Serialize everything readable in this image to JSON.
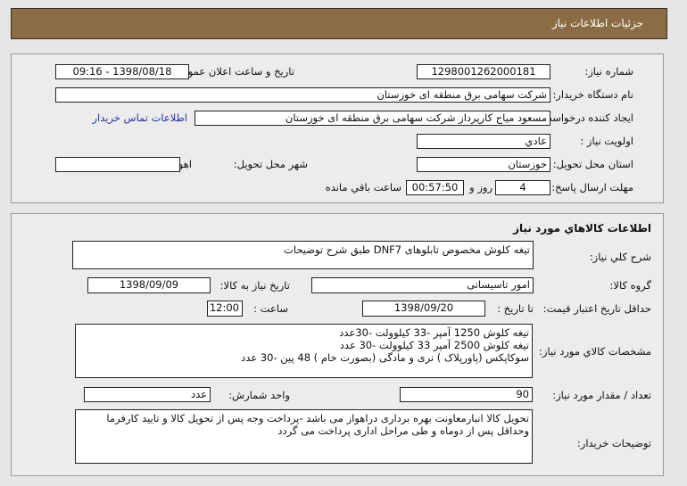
{
  "header": {
    "title": "جزئیات اطلاعات نیاز"
  },
  "need_info": {
    "need_number_label": "شماره نیاز:",
    "need_number": "1298001262000181",
    "announce_label": "تاریخ و ساعت اعلان عمومی:",
    "announce_value": "1398/08/18 - 09:16",
    "buyer_org_label": "نام دستگاه خریدار:",
    "buyer_org": "شرکت سهامی برق منطقه ای خوزستان",
    "creator_label": "ایجاد کننده درخواست:",
    "creator": "مسعود میاح کارپرداز شرکت سهامی برق منطقه ای خوزستان",
    "contact_link": "اطلاعات تماس خریدار",
    "priority_label": "اولویت نیاز :",
    "priority": "عادي",
    "province_label": "استان محل تحویل:",
    "province": "خوزستان",
    "city_label": "شهر محل تحویل:",
    "city": "اهواز",
    "deadline_label": "مهلت ارسال پاسخ:",
    "days": "4",
    "days_suffix": "روز و",
    "time_left": "00:57:50",
    "time_suffix": "ساعت باقي مانده"
  },
  "goods": {
    "section_title": "اطلاعات کالاهاي مورد نياز",
    "summary_label": "شرح کلي نياز:",
    "summary": "تیغه کلوش مخصوص تابلوهای DNF7 طبق شرح توضیحات",
    "group_label": "گروه کالا:",
    "group": "امور تاسیساتی",
    "need_date_label": "تاریخ نیاز به کالا:",
    "need_date": "1398/09/09",
    "price_valid_label": "حداقل تاریخ اعتبار قیمت:",
    "to_date_label": "تا تاریخ :",
    "to_date": "1398/09/20",
    "hour_label": "ساعت :",
    "hour": "12:00",
    "spec_label": "مشخصات کالاي مورد نياز:",
    "spec": "تیغه کلوش 1250 آمپر -33 کیلوولت -30عدد\nتیغه کلوش 2500 آمپر 33 کیلوولت -30 عدد\nسوکاپکس (پاورپلاک ) نری و مادگی (بصورت خام ) 48 پین -30 عدد",
    "qty_label": "تعداد / مقدار مورد نیاز:",
    "qty": "90",
    "unit_label": "واحد شمارش:",
    "unit": "عدد",
    "notes_label": "توضیحات خریدار:",
    "notes": "تحویل کالا انبارمعاونت بهره برداری دراهواز می باشد -پرداخت وجه پس از تحویل کالا و تایید کارفرما\nوحداقل پس از دوماه و طی مراحل اداری پرداخت می گردد"
  }
}
